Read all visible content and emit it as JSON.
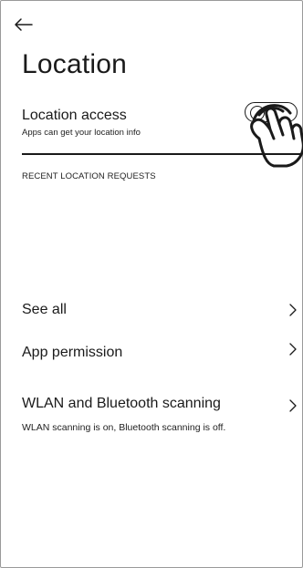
{
  "header": {
    "title": "Location"
  },
  "location_access": {
    "label": "Location access",
    "description": "Apps can get your location info",
    "toggle_state": "off"
  },
  "recent_requests": {
    "heading": "RECENT LOCATION REQUESTS"
  },
  "rows": [
    {
      "label": "See all"
    },
    {
      "label": "App permission"
    },
    {
      "label": "WLAN and Bluetooth scanning",
      "description": "WLAN scanning is on, Bluetooth scanning is off."
    }
  ],
  "icons": {
    "back": "back-arrow-icon",
    "chevron": "chevron-right-icon",
    "hand": "tap-hand-icon"
  }
}
